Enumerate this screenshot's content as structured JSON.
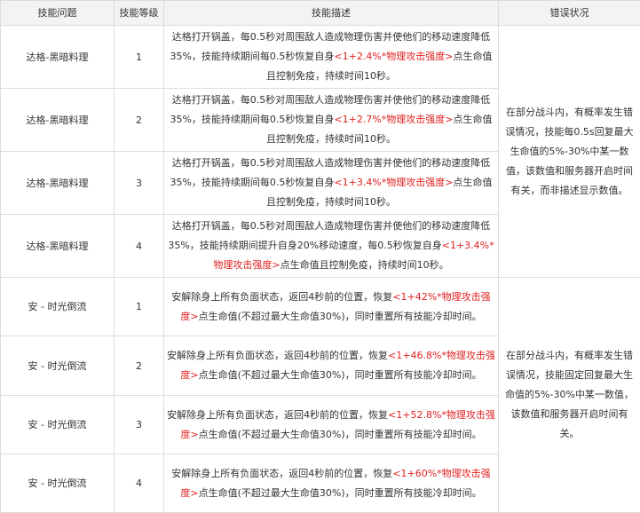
{
  "headers": [
    "技能问题",
    "技能等级",
    "技能描述",
    "错误状况"
  ],
  "rows": [
    {
      "skill": "达格-黑暗料理",
      "level": "1",
      "pre": "达格打开锅盖，每0.5秒对周围敌人造成物理伤害并使他们的移动速度降低35%，技能持续期间每0.5秒恢复自身",
      "red": "<1+2.4%*物理攻击强度>",
      "post": "点生命值且控制免疫，持续时间10秒。"
    },
    {
      "skill": "达格-黑暗料理",
      "level": "2",
      "pre": "达格打开锅盖，每0.5秒对周围敌人造成物理伤害并使他们的移动速度降低35%，技能持续期间每0.5秒恢复自身",
      "red": "<1+2.7%*物理攻击强度>",
      "post": "点生命值且控制免疫，持续时间10秒。"
    },
    {
      "skill": "达格-黑暗料理",
      "level": "3",
      "pre": "达格打开锅盖，每0.5秒对周围敌人造成物理伤害并使他们的移动速度降低35%，技能持续期间每0.5秒恢复自身",
      "red": "<1+3.4%*物理攻击强度>",
      "post": "点生命值且控制免疫，持续时间10秒。"
    },
    {
      "skill": "达格-黑暗料理",
      "level": "4",
      "pre": "达格打开锅盖，每0.5秒对周围敌人造成物理伤害并使他们的移动速度降低35%，技能持续期间提升自身20%移动速度，每0.5秒恢复自身",
      "red": "<1+3.4%*物理攻击强度>",
      "post": "点生命值且控制免疫，持续时间10秒。"
    },
    {
      "skill": "安 - 时光倒流",
      "level": "1",
      "pre": "安解除身上所有负面状态，返回4秒前的位置，恢复",
      "red": "<1+42%*物理攻击强度>",
      "post": "点生命值(不超过最大生命值30%)，同时重置所有技能冷却时间。"
    },
    {
      "skill": "安 - 时光倒流",
      "level": "2",
      "pre": "安解除身上所有负面状态，返回4秒前的位置，恢复",
      "red": "<1+46.8%*物理攻击强度>",
      "post": "点生命值(不超过最大生命值30%)，同时重置所有技能冷却时间。"
    },
    {
      "skill": "安 - 时光倒流",
      "level": "3",
      "pre": "安解除身上所有负面状态，返回4秒前的位置，恢复",
      "red": "<1+52.8%*物理攻击强度>",
      "post": "点生命值(不超过最大生命值30%)，同时重置所有技能冷却时间。"
    },
    {
      "skill": "安 - 时光倒流",
      "level": "4",
      "pre": "安解除身上所有负面状态，返回4秒前的位置，恢复",
      "red": "<1+60%*物理攻击强度>",
      "post": "点生命值(不超过最大生命值30%)，同时重置所有技能冷却时间。"
    }
  ],
  "errors": [
    "在部分战斗内，有概率发生错误情况，技能每0.5s回复最大生命值的5%-30%中某一数值，该数值和服务器开启时间有关，而非描述显示数值。",
    "在部分战斗内，有概率发生错误情况，技能固定回复最大生命值的5%-30%中某一数值，该数值和服务器开启时间有关。"
  ]
}
